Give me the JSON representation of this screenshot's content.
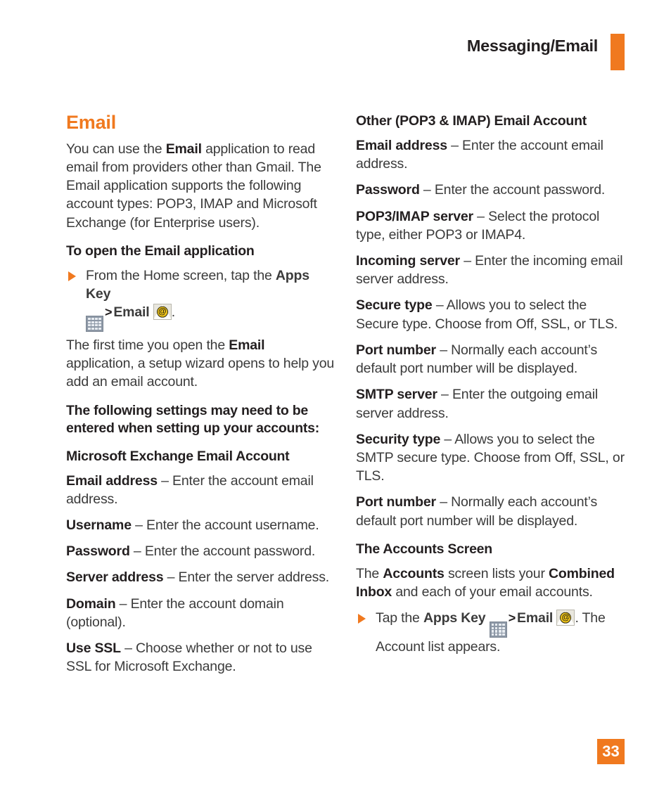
{
  "header": {
    "title": "Messaging/Email",
    "accent_color": "#F0791F"
  },
  "page_number": "33",
  "left_column": {
    "section_title": "Email",
    "intro_paragraph": {
      "pre": "You can use the ",
      "bold": "Email",
      "post": " application to read email from providers other than Gmail. The Email application supports the following account types: POP3, IMAP and Microsoft Exchange (for Enterprise users)."
    },
    "subheading_open": "To open the Email application",
    "bullet_open": {
      "pre": "From the Home screen, tap the ",
      "bold_apps": "Apps Key",
      "sep": ">",
      "bold_email": "Email",
      "post": "."
    },
    "first_time_paragraph": {
      "pre": "The first time you open the ",
      "bold": "Email",
      "post": " application, a setup wizard opens to help you add an email account."
    },
    "settings_notice": "The following settings may need to be entered when setting up your accounts:",
    "exchange_heading": "Microsoft Exchange Email Account",
    "exchange_settings": [
      {
        "term": "Email address",
        "desc": " – Enter the account email address."
      },
      {
        "term": "Username",
        "desc": " – Enter the account username."
      },
      {
        "term": "Password",
        "desc": " – Enter the account password."
      },
      {
        "term": "Server address",
        "desc": " – Enter the server address."
      },
      {
        "term": "Domain",
        "desc": " – Enter the account domain (optional)."
      },
      {
        "term": "Use SSL",
        "desc": " – Choose whether or not to use SSL for Microsoft Exchange."
      }
    ]
  },
  "right_column": {
    "other_heading": "Other (POP3 & IMAP) Email Account",
    "other_settings": [
      {
        "term": "Email address",
        "desc": " – Enter the account email address."
      },
      {
        "term": "Password",
        "desc": " – Enter the account password."
      },
      {
        "term": "POP3/IMAP server",
        "desc": " – Select the protocol type, either POP3 or IMAP4."
      },
      {
        "term": "Incoming server",
        "desc": " – Enter the incoming email server address."
      },
      {
        "term": "Secure type",
        "desc": " – Allows you to select the Secure type. Choose from Off, SSL, or TLS."
      },
      {
        "term": "Port number",
        "desc": " – Normally each account’s default port number will be displayed."
      },
      {
        "term": "SMTP server",
        "desc": " – Enter the outgoing email server address."
      },
      {
        "term": "Security type",
        "desc": " – Allows you to select the SMTP secure type. Choose from Off, SSL, or TLS."
      },
      {
        "term": "Port number",
        "desc": " – Normally each account’s default port number will be displayed."
      }
    ],
    "accounts_heading": "The Accounts Screen",
    "accounts_paragraph": {
      "p1": "The ",
      "b1": "Accounts",
      "p2": " screen lists your ",
      "b2": "Combined Inbox",
      "p3": " and each of your email accounts."
    },
    "bullet_accounts": {
      "pre": "Tap the ",
      "bold_apps": "Apps Key",
      "sep": ">",
      "bold_email": "Email",
      "post": ". The Account list appears."
    }
  },
  "icons": {
    "apps_key": "apps-key-grid-icon",
    "email": "email-envelope-at-icon",
    "bullet": "orange-triangle-bullet-icon"
  }
}
